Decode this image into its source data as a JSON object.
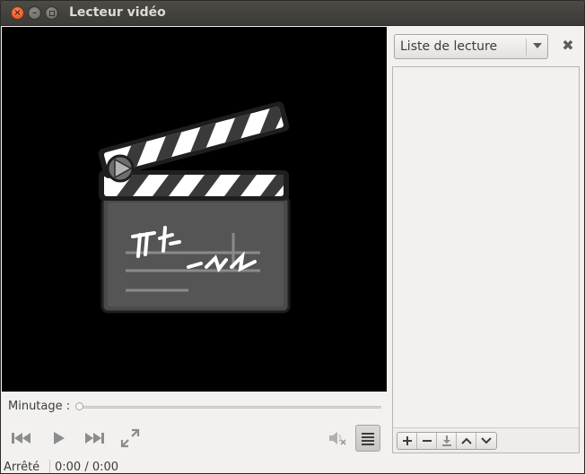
{
  "window": {
    "title": "Lecteur vidéo"
  },
  "controls": {
    "timer_label": "Minutage :",
    "seek_fraction": 0.0,
    "prev_icon": "skip-previous-icon",
    "play_icon": "play-icon",
    "next_icon": "skip-next-icon",
    "fullscreen_icon": "fullscreen-icon",
    "mute_icon": "volume-muted-icon",
    "playlist_icon": "list-icon"
  },
  "status": {
    "state": "Arrêté",
    "time": "0:00 / 0:00"
  },
  "sidebar": {
    "selected": "Liste de lecture",
    "close_icon": "close-icon",
    "tools": [
      "add-icon",
      "remove-icon",
      "save-icon",
      "move-up-icon",
      "move-down-icon"
    ]
  },
  "colors": {
    "titlebar": "#3c3b37",
    "close_button": "#df4b16",
    "background": "#f2f1f0"
  }
}
